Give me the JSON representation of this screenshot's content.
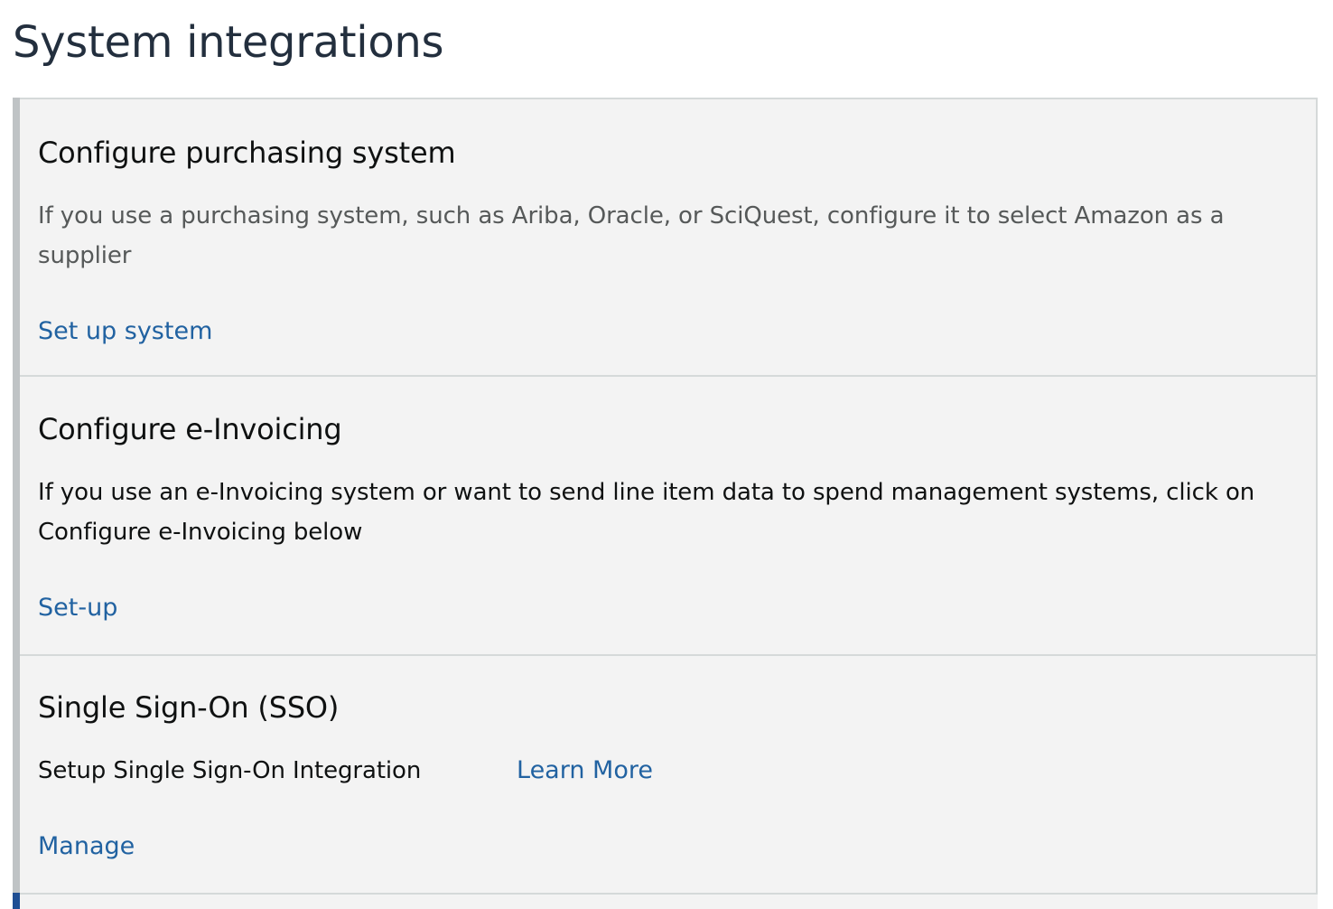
{
  "page": {
    "title": "System integrations"
  },
  "cards": [
    {
      "title": "Configure purchasing system",
      "description": "If you use a purchasing system, such as Ariba, Oracle, or SciQuest, configure it to select Amazon as a supplier",
      "action_label": "Set up system"
    },
    {
      "title": "Configure e-Invoicing",
      "description": "If you use an e-Invoicing system or want to send line item data to spend management systems, click on Configure e-Invoicing below",
      "action_label": "Set-up"
    },
    {
      "title": "Single Sign-On (SSO)",
      "description": "Setup Single Sign-On Integration",
      "learn_more_label": "Learn More",
      "action_label": "Manage"
    }
  ],
  "colors": {
    "link": "#2162a1",
    "card_background": "#f3f3f3",
    "card_accent_bar": "#bfc3c5",
    "active_accent_bar": "#1f4e93",
    "title_text": "#232f3e"
  }
}
